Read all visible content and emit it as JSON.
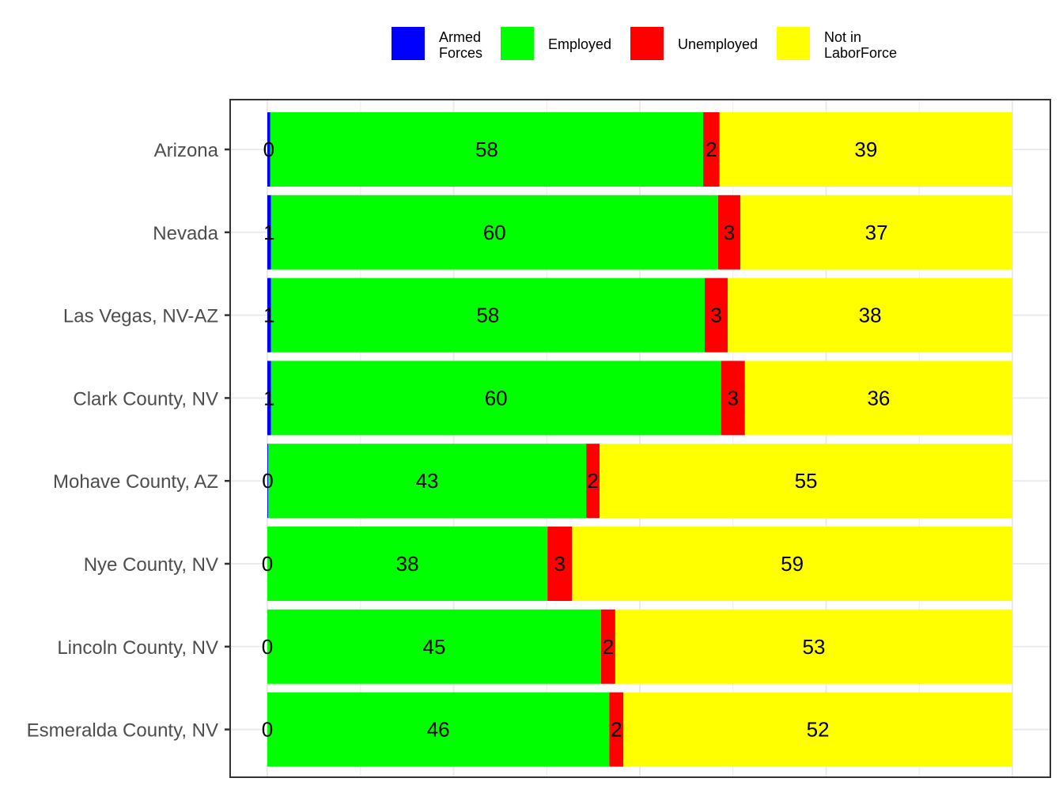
{
  "chart_data": {
    "type": "bar",
    "orientation": "horizontal",
    "stacked": true,
    "title": "",
    "xlabel": "",
    "ylabel": "",
    "xlim": [
      0,
      100
    ],
    "x_tick_labels_shown": false,
    "grid": true,
    "legend_position": "top",
    "categories": [
      "Arizona",
      "Nevada",
      "Las Vegas, NV-AZ",
      "Clark County, NV",
      "Mohave County, AZ",
      "Nye County, NV",
      "Lincoln County, NV",
      "Esmeralda County, NV"
    ],
    "series": [
      {
        "name": "Armed Forces",
        "legend_label": [
          "Armed",
          "Forces"
        ],
        "color": "#0000ff",
        "values": [
          0.4,
          0.5,
          0.5,
          0.5,
          0.1,
          0.0,
          0.0,
          0.0
        ],
        "labels": [
          "0",
          "1",
          "1",
          "1",
          "0",
          "0",
          "0",
          "0"
        ]
      },
      {
        "name": "Employed",
        "legend_label": [
          "Employed"
        ],
        "color": "#00ff00",
        "values": [
          58.1,
          60.0,
          58.2,
          60.4,
          42.7,
          37.6,
          44.8,
          45.9
        ],
        "labels": [
          "58",
          "60",
          "58",
          "60",
          "43",
          "38",
          "45",
          "46"
        ]
      },
      {
        "name": "Unemployed",
        "legend_label": [
          "Unemployed"
        ],
        "color": "#ff0000",
        "values": [
          2.2,
          3.0,
          3.1,
          3.2,
          1.8,
          3.3,
          1.9,
          1.9
        ],
        "labels": [
          "2",
          "3",
          "3",
          "3",
          "2",
          "3",
          "2",
          "2"
        ]
      },
      {
        "name": "Not in LaborForce",
        "legend_label": [
          "Not in",
          "LaborForce"
        ],
        "color": "#ffff00",
        "values": [
          39.3,
          36.5,
          38.2,
          35.9,
          55.4,
          59.1,
          53.3,
          52.2
        ],
        "labels": [
          "39",
          "37",
          "38",
          "36",
          "55",
          "59",
          "53",
          "52"
        ]
      }
    ]
  }
}
